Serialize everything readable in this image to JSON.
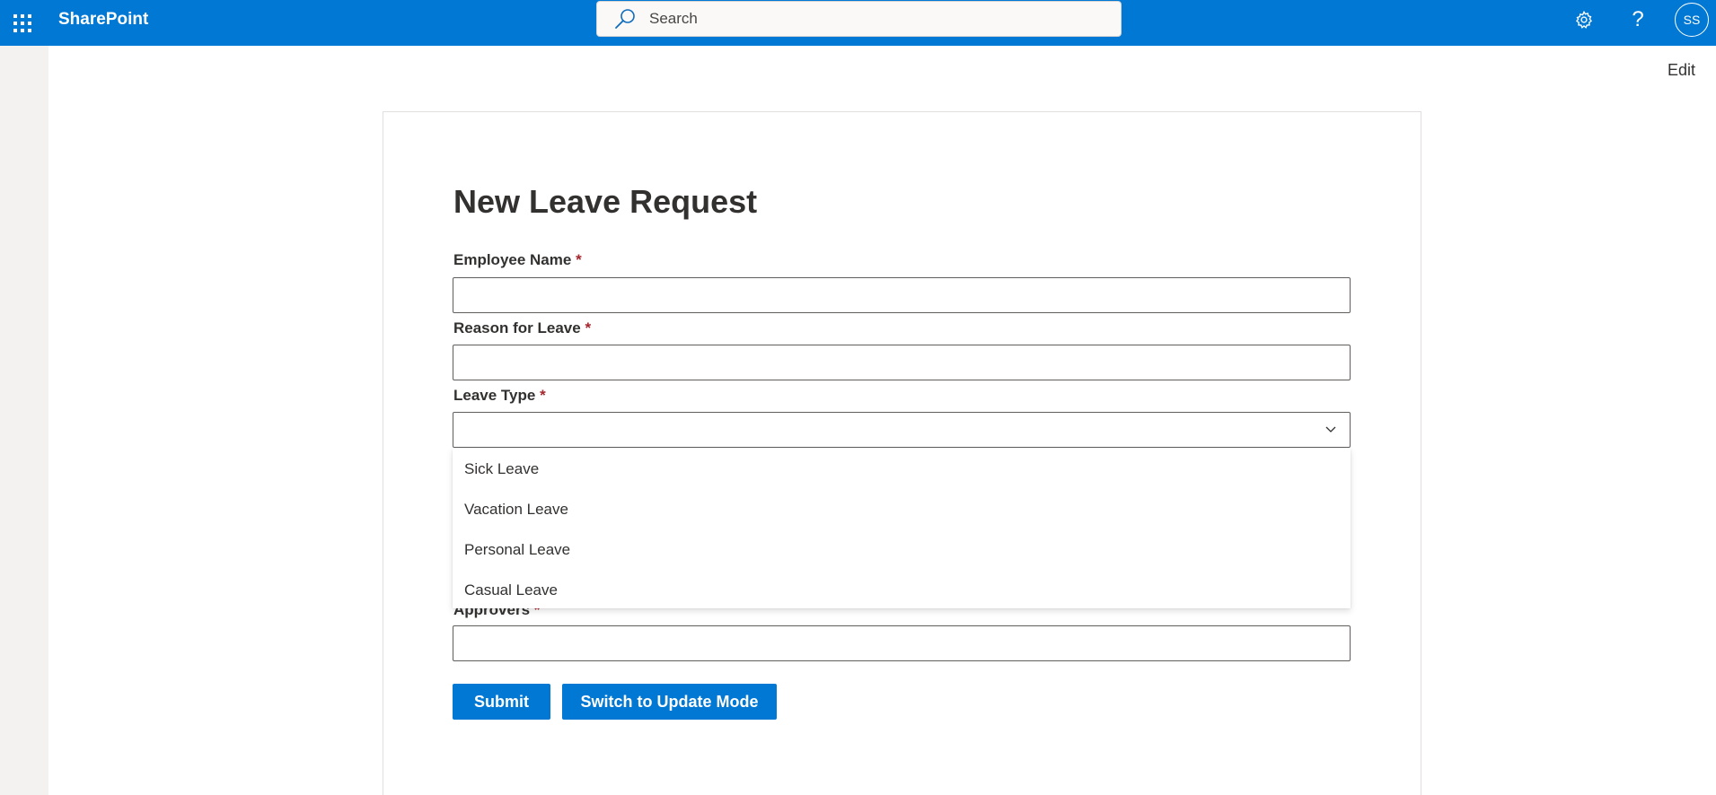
{
  "suitebar": {
    "app_name": "SharePoint",
    "search_placeholder": "Search",
    "avatar_initials": "SS",
    "help_glyph": "?",
    "icons": {
      "waffle": "app-launcher-icon",
      "search": "search-icon",
      "settings": "gear-icon",
      "help": "help-icon"
    }
  },
  "page": {
    "edit_label": "Edit"
  },
  "form": {
    "title": "New Leave Request",
    "required_marker": "*",
    "fields": {
      "employee_name": {
        "label": "Employee Name",
        "value": ""
      },
      "reason": {
        "label": "Reason for Leave",
        "value": ""
      },
      "leave_type": {
        "label": "Leave Type",
        "value": ""
      },
      "approvers": {
        "label": "Approvers",
        "value": ""
      }
    },
    "leave_type_options": [
      "Sick Leave",
      "Vacation Leave",
      "Personal Leave",
      "Casual Leave"
    ],
    "buttons": {
      "submit": "Submit",
      "switch_mode": "Switch to Update Mode"
    }
  },
  "colors": {
    "brand_blue": "#0078d4",
    "required_red": "#a4262c",
    "rail_gray": "#f3f2f1"
  }
}
